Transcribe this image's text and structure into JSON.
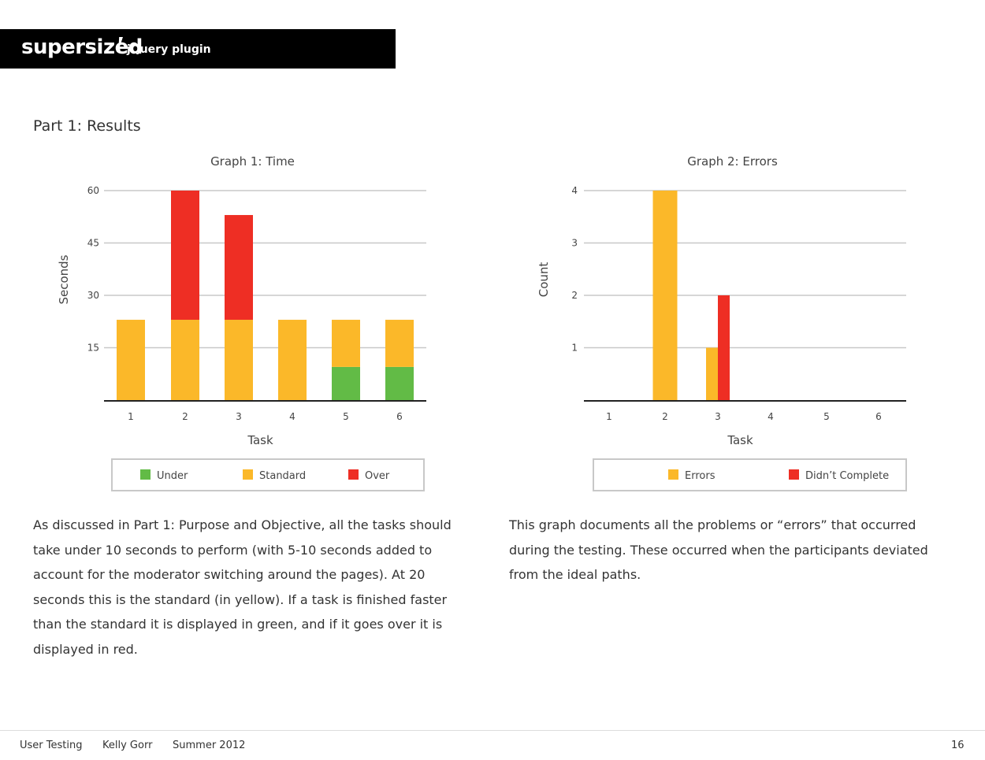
{
  "banner": {
    "brand": "supersized",
    "bang": "!",
    "subtitle": "jQuery plugin"
  },
  "section_title": "Part 1: Results",
  "chart_data": [
    {
      "type": "bar",
      "stacked": true,
      "title": "Graph 1: Time",
      "xlabel": "Task",
      "ylabel": "Seconds",
      "categories": [
        "1",
        "2",
        "3",
        "4",
        "5",
        "6"
      ],
      "ylim": [
        0,
        60
      ],
      "yticks": [
        "15",
        "30",
        "45",
        "60"
      ],
      "grid": true,
      "legend_position": "bottom",
      "series": [
        {
          "name": "Under",
          "color": "#62bb46",
          "values": [
            0,
            0,
            0,
            0,
            9.5,
            9.5
          ]
        },
        {
          "name": "Standard",
          "color": "#fbb829",
          "values": [
            23,
            23,
            23,
            23,
            13.5,
            13.5
          ]
        },
        {
          "name": "Over",
          "color": "#ee2e24",
          "values": [
            0,
            37,
            30,
            0,
            0,
            0
          ]
        }
      ]
    },
    {
      "type": "bar",
      "stacked": false,
      "title": "Graph 2: Errors",
      "xlabel": "Task",
      "ylabel": "Count",
      "categories": [
        "1",
        "2",
        "3",
        "4",
        "5",
        "6"
      ],
      "ylim": [
        0,
        4
      ],
      "yticks": [
        "1",
        "2",
        "3",
        "4"
      ],
      "grid": true,
      "legend_position": "bottom",
      "series": [
        {
          "name": "Errors",
          "color": "#fbb829",
          "values": [
            0,
            4,
            1,
            0,
            0,
            0
          ]
        },
        {
          "name": "Didn’t Complete",
          "color": "#ee2e24",
          "values": [
            0,
            0,
            2,
            0,
            0,
            0
          ]
        }
      ]
    }
  ],
  "paragraphs": {
    "left": [
      "As discussed in Part 1: Purpose and Objective, all the tasks should",
      "take under 10 seconds to perform (with 5-10 seconds added to",
      "account for the moderator switching around the pages).  At 20",
      "seconds this is the standard (in yellow).  If a task is finished faster",
      "than the standard it is displayed in green, and if it goes over it is",
      "displayed in red."
    ],
    "right": [
      "This graph documents all the problems or “errors” that occurred",
      "during the testing.  These occurred when the participants deviated",
      "from the ideal paths."
    ]
  },
  "footer": {
    "doc": "User Testing",
    "author": "Kelly Gorr",
    "date": "Summer 2012",
    "page": "16"
  }
}
